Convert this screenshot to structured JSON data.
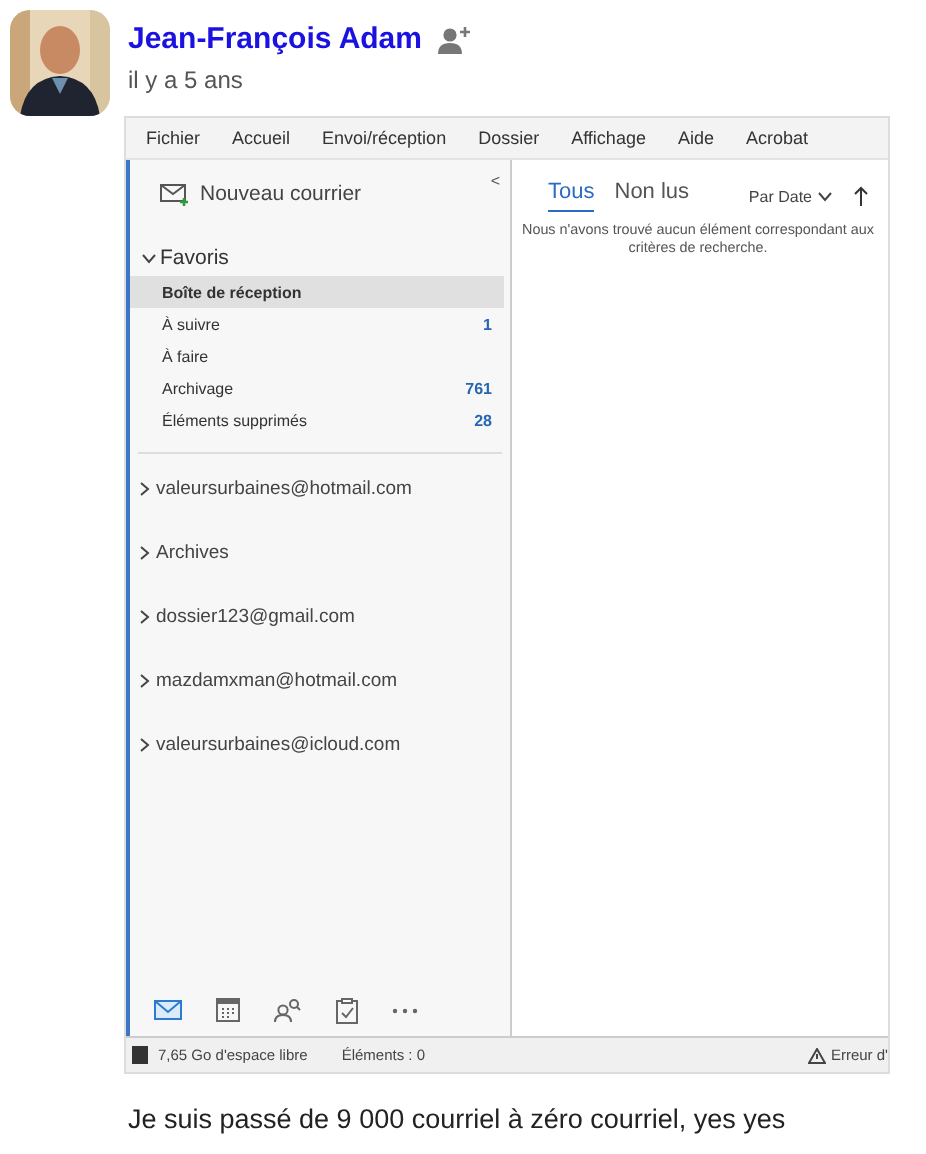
{
  "post": {
    "author": "Jean-François Adam",
    "time": "il y a 5 ans",
    "comment": "Je suis passé de 9 000 courriel à zéro courriel, yes yes"
  },
  "screenshot": {
    "menu": [
      "Fichier",
      "Accueil",
      "Envoi/réception",
      "Dossier",
      "Affichage",
      "Aide",
      "Acrobat"
    ],
    "collapse": "<",
    "new_mail": "Nouveau courrier",
    "favorites": {
      "label": "Favoris",
      "expanded": true,
      "items": [
        {
          "label": "Boîte de réception",
          "selected": true
        },
        {
          "label": "À suivre",
          "count": "1",
          "selected": false
        },
        {
          "label": "À faire",
          "selected": false
        },
        {
          "label": "Archivage",
          "count": "761",
          "selected": false
        },
        {
          "label": "Éléments supprimés",
          "count": "28",
          "selected": false
        }
      ]
    },
    "folders": [
      {
        "label": "valeursurbaines@hotmail.com",
        "expanded": false
      },
      {
        "label": "Archives",
        "expanded": false
      },
      {
        "label": "dossier123@gmail.com",
        "expanded": false
      },
      {
        "label": "mazdamxman@hotmail.com",
        "expanded": false
      },
      {
        "label": "valeursurbaines@icloud.com",
        "expanded": false
      }
    ],
    "nav": [
      {
        "kind": "mail",
        "selected": true
      },
      {
        "kind": "calendar",
        "selected": false
      },
      {
        "kind": "people",
        "selected": false
      },
      {
        "kind": "tasks",
        "selected": false
      },
      {
        "kind": "more",
        "selected": false
      }
    ],
    "list_tabs": [
      {
        "label": "Tous",
        "selected": true
      },
      {
        "label": "Non lus",
        "selected": false
      }
    ],
    "sort": "Par Date",
    "empty_message": "Nous n'avons trouvé aucun élément correspondant aux critères de recherche.",
    "status": {
      "storage": "7,65 Go d'espace libre",
      "items": "Éléments : 0",
      "error": "Erreur d'"
    }
  }
}
